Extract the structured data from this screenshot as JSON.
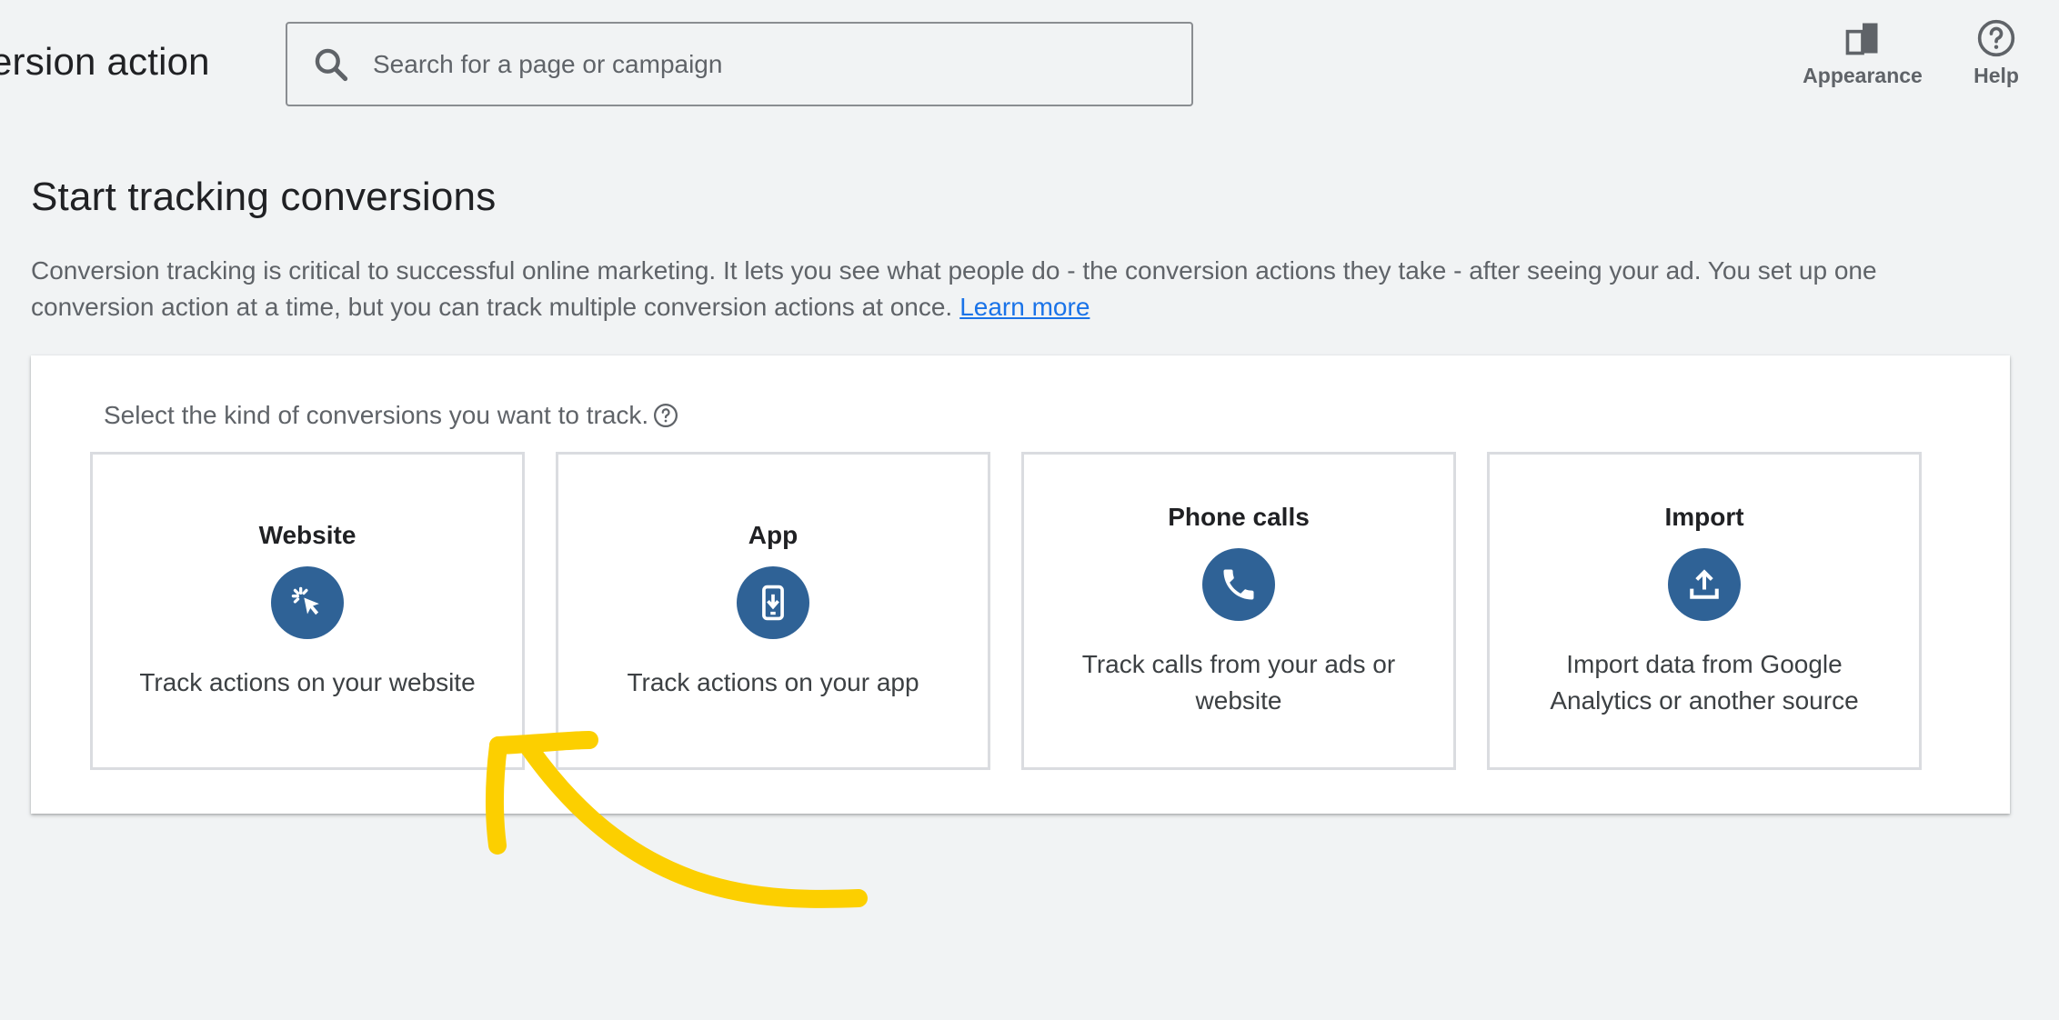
{
  "header": {
    "title": "ersion action",
    "search_placeholder": "Search for a page or campaign",
    "appearance_label": "Appearance",
    "help_label": "Help"
  },
  "intro": {
    "heading": "Start tracking conversions",
    "description": "Conversion tracking is critical to successful online marketing. It lets you see what people do - the conversion actions they take - after seeing your ad. You set up one conversion action at a time, but you can track multiple conversion actions at once.",
    "learn_more": "Learn more"
  },
  "panel": {
    "prompt": "Select the kind of conversions you want to track.",
    "cards": [
      {
        "title": "Website",
        "description": "Track actions on your website",
        "icon": "cursor-click-icon"
      },
      {
        "title": "App",
        "description": "Track actions on your app",
        "icon": "mobile-download-icon"
      },
      {
        "title": "Phone calls",
        "description": "Track calls from your ads or website",
        "icon": "phone-icon"
      },
      {
        "title": "Import",
        "description": "Import data from Google Analytics or another source",
        "icon": "upload-icon"
      }
    ]
  },
  "colors": {
    "accent": "#2f6296",
    "link": "#1a73e8",
    "annotation": "#fccf00"
  }
}
